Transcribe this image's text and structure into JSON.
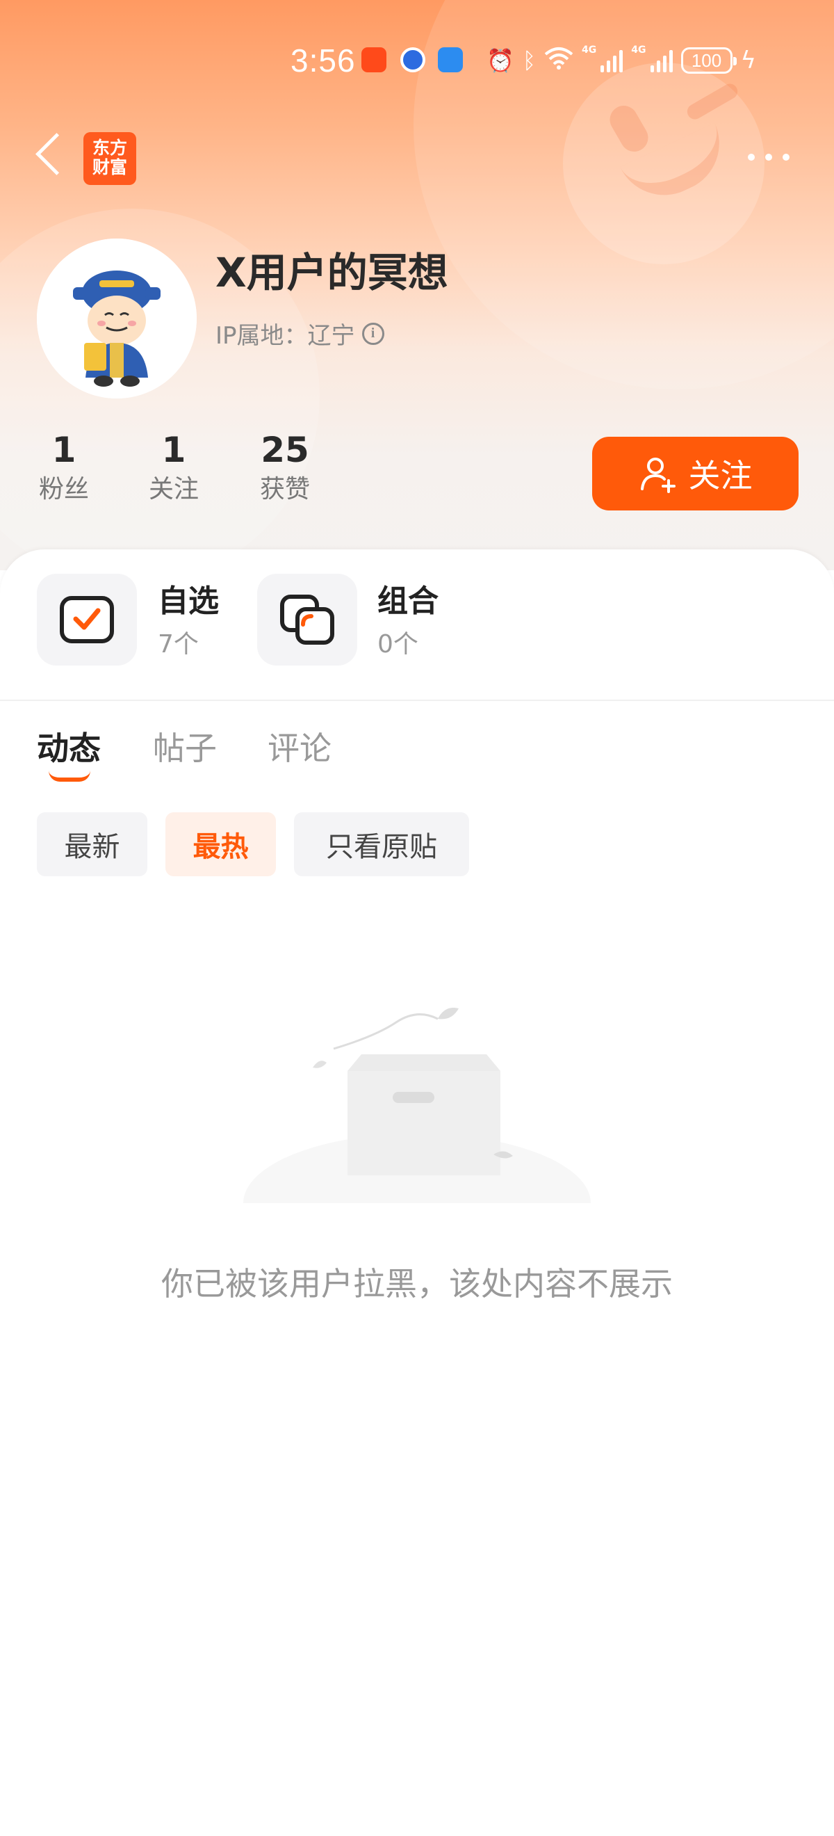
{
  "status_bar": {
    "time": "3:56",
    "battery": "100",
    "network_1": "4G",
    "network_2": "4G"
  },
  "nav": {
    "logo_text_line1": "东方",
    "logo_text_line2": "财富"
  },
  "profile": {
    "username": "X用户的冥想",
    "ip_location": "IP属地：辽宁"
  },
  "stats": [
    {
      "value": "1",
      "label": "粉丝"
    },
    {
      "value": "1",
      "label": "关注"
    },
    {
      "value": "25",
      "label": "获赞"
    }
  ],
  "follow_button": {
    "label": "关注"
  },
  "portfolio": {
    "watchlist": {
      "title": "自选",
      "count": "7个"
    },
    "combo": {
      "title": "组合",
      "count": "0个"
    }
  },
  "tabs": [
    {
      "label": "动态",
      "active": true
    },
    {
      "label": "帖子",
      "active": false
    },
    {
      "label": "评论",
      "active": false
    }
  ],
  "filters": [
    {
      "label": "最新",
      "active": false
    },
    {
      "label": "最热",
      "active": true
    },
    {
      "label": "只看原贴",
      "active": false
    }
  ],
  "empty_state": {
    "message": "你已被该用户拉黑，该处内容不展示"
  },
  "colors": {
    "accent": "#ff5a0a",
    "hero_top": "#ff9a62"
  }
}
